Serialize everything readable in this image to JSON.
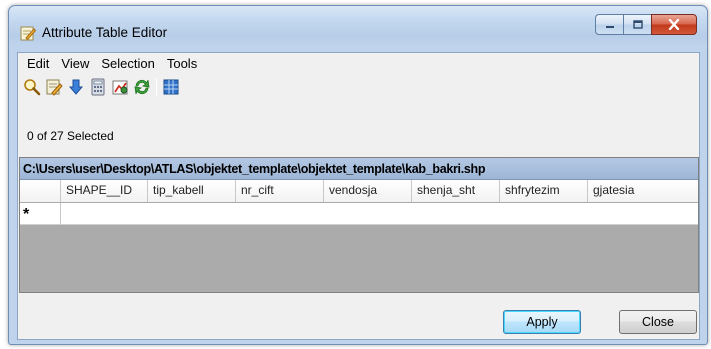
{
  "window": {
    "title": "Attribute Table Editor"
  },
  "menu": [
    "Edit",
    "View",
    "Selection",
    "Tools"
  ],
  "toolbar": {
    "icons": [
      "zoom-icon",
      "edit-icon",
      "move-down-icon",
      "calculator-icon",
      "chart-icon",
      "refresh-icon",
      "grid-icon"
    ]
  },
  "status": {
    "selection_text": "0 of 27 Selected"
  },
  "table": {
    "path": "C:\\Users\\user\\Desktop\\ATLAS\\objektet_template\\objektet_template\\kab_bakri.shp",
    "columns": [
      "SHAPE__ID",
      "tip_kabell",
      "nr_cift",
      "vendosja",
      "shenja_sht",
      "shfrytezim",
      "gjatesia"
    ],
    "new_row_marker": "*"
  },
  "buttons": {
    "apply": "Apply",
    "close": "Close"
  },
  "colors": {
    "title_gradient_top": "#d9e7f7",
    "close_button": "#c1391a",
    "caption_bar": "#9db6d7",
    "grid_background": "#ababab"
  }
}
